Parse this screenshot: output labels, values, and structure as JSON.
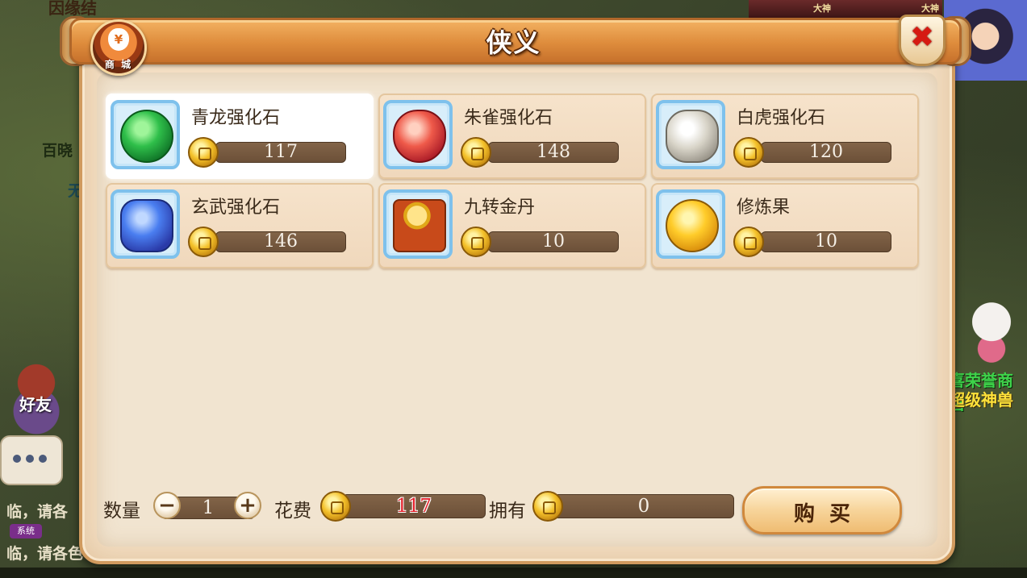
{
  "background": {
    "top_name": "因缘结",
    "name_left_1": "百晓",
    "name_left_2": "无",
    "right_text_1": "喜荣誉商店",
    "right_text_2": "超级神兽",
    "friends_label": "好友",
    "chat_line_1": "临，请各",
    "chat_line_2": "临，请各色",
    "system_badge": "系统",
    "topbar_label_1": "大神",
    "topbar_label_2": "大神"
  },
  "dialog": {
    "title": "侠义",
    "shop_badge_label": "商 城",
    "close_icon": "close-x"
  },
  "items": [
    {
      "name": "青龙强化石",
      "price": "117",
      "icon": "azure-dragon-stone",
      "selected": true
    },
    {
      "name": "朱雀强化石",
      "price": "148",
      "icon": "vermilion-bird-stone",
      "selected": false
    },
    {
      "name": "白虎强化石",
      "price": "120",
      "icon": "white-tiger-stone",
      "selected": false
    },
    {
      "name": "玄武强化石",
      "price": "146",
      "icon": "black-tortoise-stone",
      "selected": false
    },
    {
      "name": "九转金丹",
      "price": "10",
      "icon": "golden-elixir-chest",
      "selected": false
    },
    {
      "name": "修炼果",
      "price": "10",
      "icon": "cultivation-fruit",
      "selected": false
    }
  ],
  "footer": {
    "quantity_label": "数量",
    "quantity_value": "1",
    "minus_symbol": "−",
    "plus_symbol": "+",
    "cost_label": "花费",
    "cost_value": "117",
    "owned_label": "拥有",
    "owned_value": "0",
    "buy_label": "购买"
  },
  "colors": {
    "cost_value": "#e4202a",
    "accent_orange": "#de8c3c",
    "panel": "#f1e4d0",
    "close_red": "#d61a12"
  }
}
